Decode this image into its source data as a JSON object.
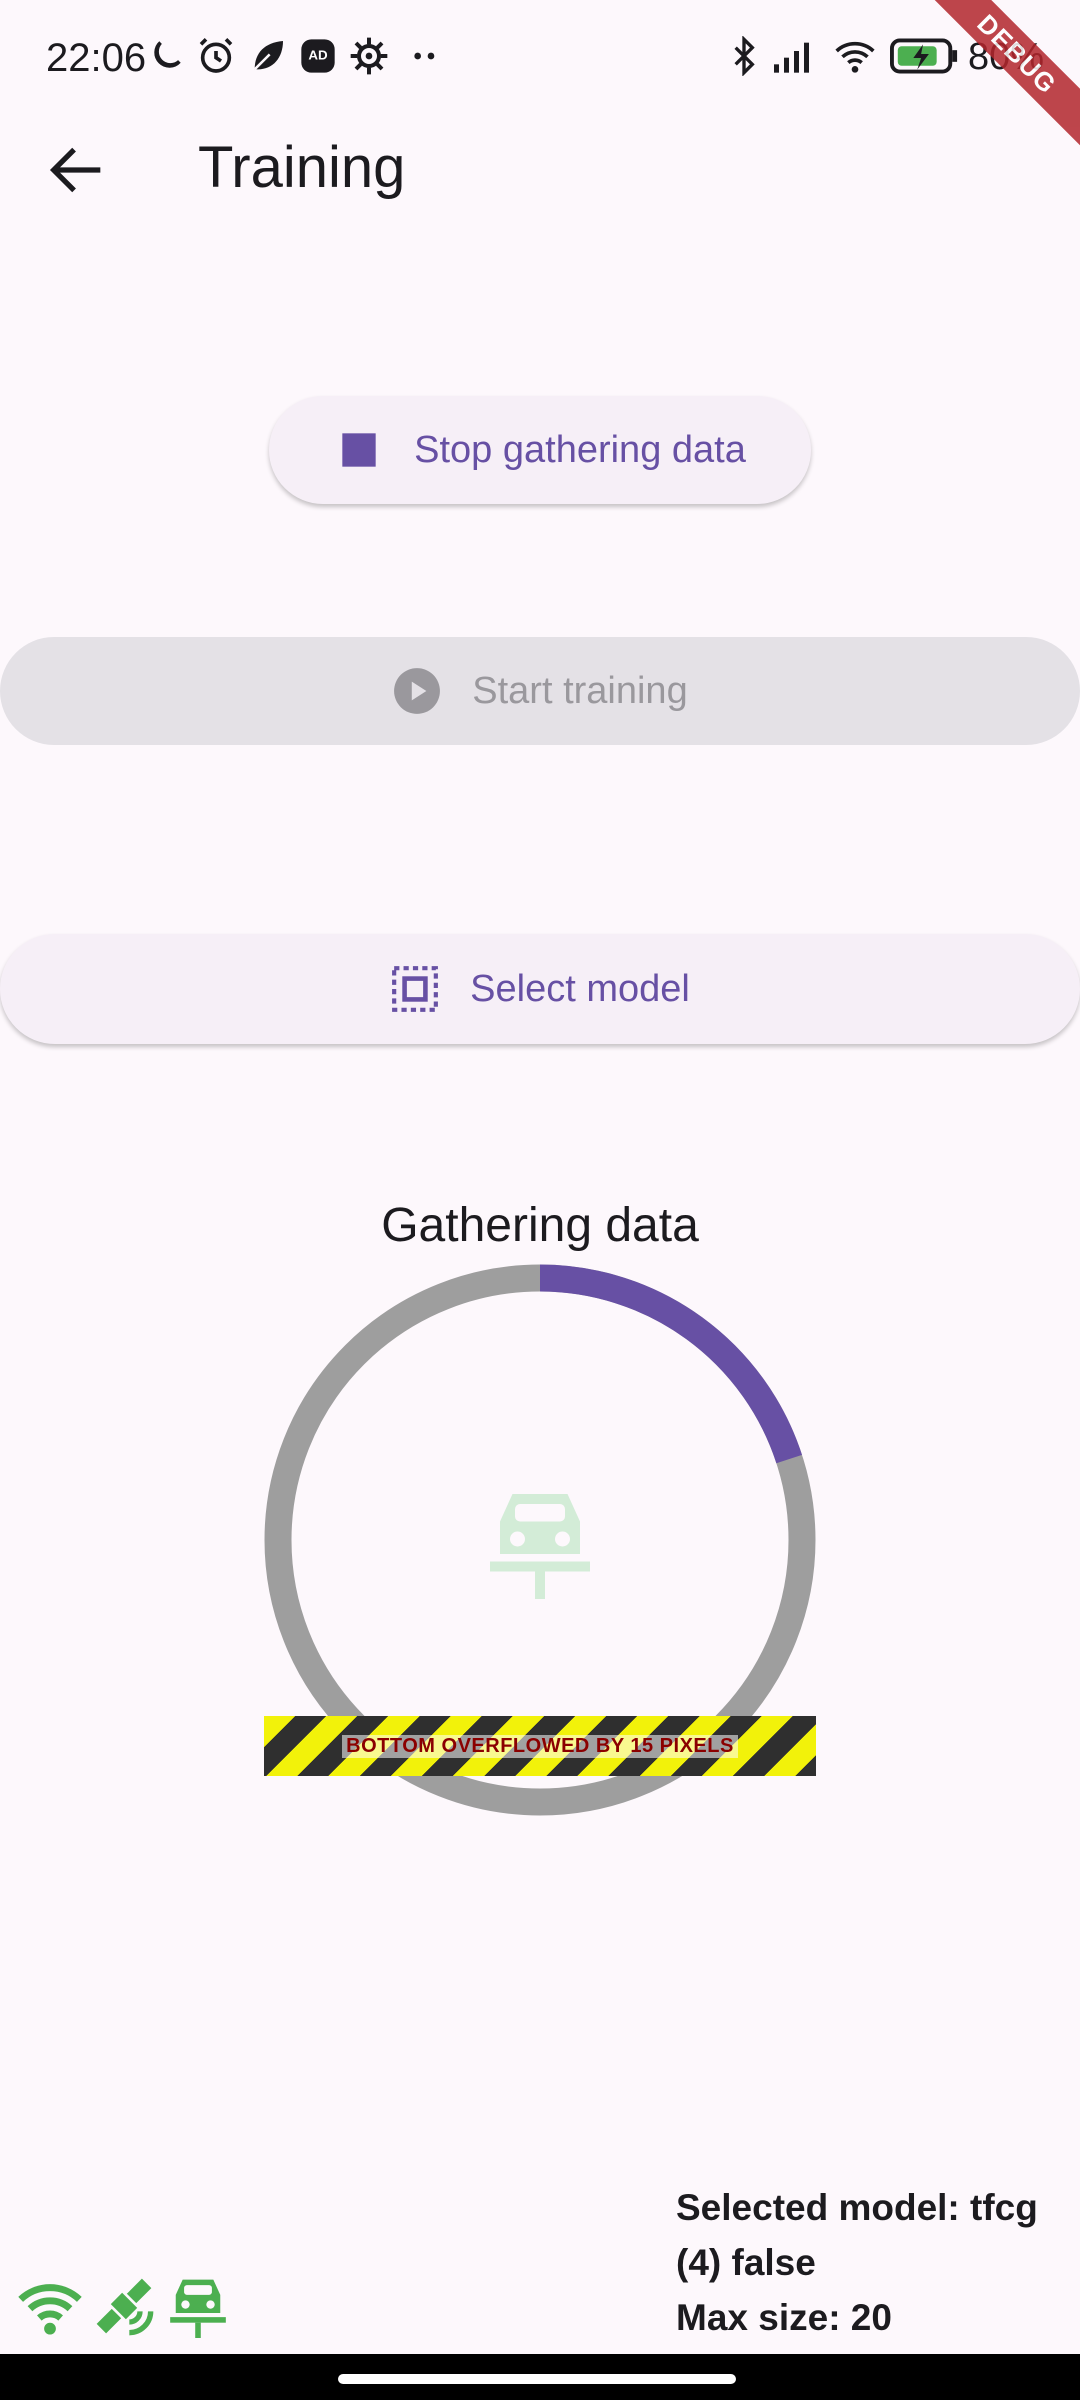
{
  "status_bar": {
    "time": "22:06",
    "battery": "80%",
    "left_icons": [
      "moon-icon",
      "alarm-icon",
      "leaf-icon",
      "adblock-icon",
      "settings-icon",
      "more-icon"
    ],
    "right_icons": [
      "bluetooth-icon",
      "signal-icon",
      "wifi-icon",
      "battery-charging-icon"
    ]
  },
  "debug_banner": "DEBUG",
  "app_bar": {
    "title": "Training",
    "back_icon": "arrow-back-icon"
  },
  "buttons": {
    "stop": {
      "label": "Stop gathering data",
      "icon": "stop-icon"
    },
    "start": {
      "label": "Start training",
      "icon": "play-circle-icon",
      "disabled": true
    },
    "select": {
      "label": "Select model",
      "icon": "select-all-icon"
    }
  },
  "progress": {
    "title": "Gathering data",
    "fraction": 0.2,
    "center_icon": "car-icon",
    "colors": {
      "track": "#9e9e9e",
      "fill": "#6750a4",
      "car": "#d3ecd7"
    }
  },
  "overflow_warning": "BOTTOM OVERFLOWED BY 15 PIXELS",
  "bottom_icons": [
    "wifi-icon",
    "satellite-icon",
    "car-icon"
  ],
  "bottom_icon_color": "#4caf50",
  "info": {
    "selected_model": "Selected model: tfcg",
    "status": "(4) false",
    "max_size": "Max size: 20"
  },
  "colors": {
    "accent": "#6750a4",
    "background": "#fdf8fc",
    "disabled_bg": "#e4e1e6",
    "disabled_text": "#9a989d"
  }
}
